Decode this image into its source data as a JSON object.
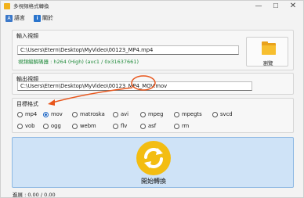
{
  "window": {
    "title": "多視頻格式轉換",
    "minimize_glyph": "—",
    "maximize_glyph": "☐",
    "close_glyph": "✕"
  },
  "menu": {
    "language_label": "語言",
    "about_label": "關於",
    "language_icon": "translate-icon",
    "about_icon": "info-icon"
  },
  "input": {
    "group_title": "輸入視頻",
    "path_value": "C:\\Users\\Etern\\Desktop\\MyVideo\\00123_MP4.mp4",
    "codec_info": "視頻編解碼器 : h264 (High) (avc1 / 0x31637661)",
    "browse_label": "瀏覽",
    "browse_icon": "folder-icon"
  },
  "output": {
    "group_title": "輸出視頻",
    "path_value": "C:\\Users\\Etern\\Desktop\\MyVideo\\00123_MP4_MOV.mov"
  },
  "format": {
    "group_title": "目標格式",
    "options": [
      "mp4",
      "mov",
      "matroska",
      "avi",
      "mpeg",
      "mpegts",
      "svcd",
      "vob",
      "ogg",
      "webm",
      "flv",
      "asf",
      "rm"
    ],
    "selected": "mov"
  },
  "start": {
    "label": "開始轉換",
    "icon": "sync-icon"
  },
  "progress": {
    "text": "進展 : 0.00 / 0.00"
  },
  "colors": {
    "accent": "#1e66c4",
    "codec_text": "#1f8a3a",
    "start_bg": "#cfe3f7",
    "annotation": "#e8561c",
    "folder": "#f7bf2f",
    "sync_icon": "#f3bd12"
  }
}
